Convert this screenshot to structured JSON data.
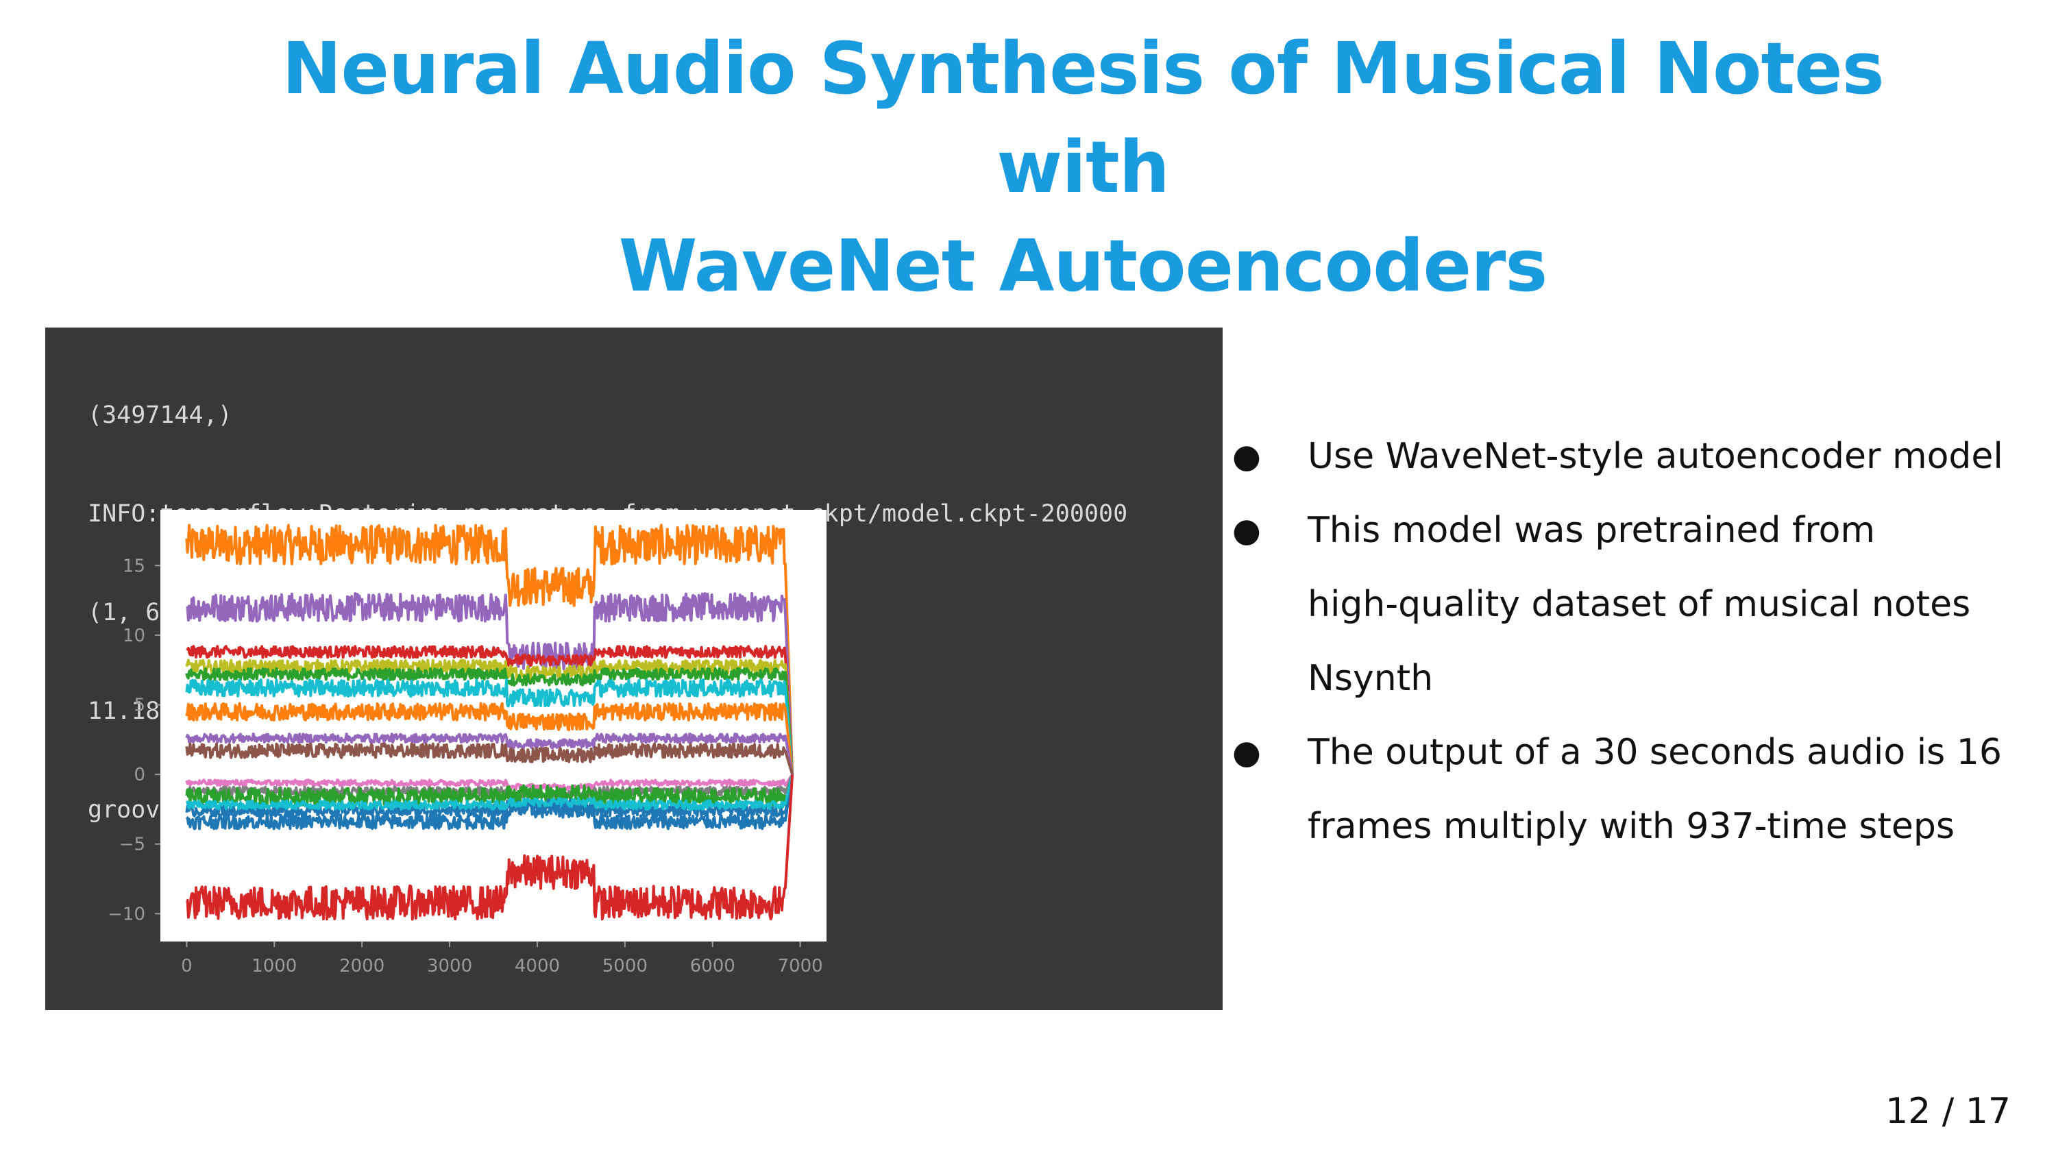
{
  "slide": {
    "title_line1": "Neural Audio Synthesis of Musical Notes with",
    "title_line2": "WaveNet Autoencoders",
    "page_number": "12 / 17"
  },
  "console": {
    "lines": [
      "(3497144,)",
      "INFO:tensorflow:Restoring parameters from wavenet-ckpt/model.ckpt-200000",
      "(1, 6830, 16)",
      "11.186204195022583",
      "groovy and funny"
    ]
  },
  "bullets": [
    {
      "lines": [
        "Use WaveNet-style autoencoder model"
      ]
    },
    {
      "lines": [
        "This model was pretrained from",
        "high-quality dataset of musical notes",
        "Nsynth"
      ]
    },
    {
      "lines": [
        "The output of a 30 seconds audio is 16",
        "frames multiply with 937-time steps"
      ]
    }
  ],
  "chart_data": {
    "type": "line",
    "xlim": [
      -300,
      7300
    ],
    "ylim": [
      -12,
      19
    ],
    "x_ticks": [
      0,
      1000,
      2000,
      3000,
      4000,
      5000,
      6000,
      7000
    ],
    "x_tick_labels": [
      "0",
      "1000",
      "2000",
      "3000",
      "4000",
      "5000",
      "6000",
      "7000"
    ],
    "y_ticks": [
      15,
      10,
      5,
      0,
      -5,
      -10
    ],
    "y_tick_labels": [
      "15",
      "10",
      "5",
      "0",
      "−5",
      "−10"
    ],
    "x_end": 6830,
    "n_series": 16,
    "series": [
      {
        "color": "#ff7f0e",
        "levels": [
          16.5,
          13.5,
          16.5
        ],
        "noise": 1.4
      },
      {
        "color": "#9467bd",
        "levels": [
          12.0,
          8.5,
          12.0
        ],
        "noise": 1.0
      },
      {
        "color": "#d62728",
        "levels": [
          8.8,
          8.2,
          8.8
        ],
        "noise": 0.4
      },
      {
        "color": "#bcbd22",
        "levels": [
          7.7,
          7.3,
          7.7
        ],
        "noise": 0.5
      },
      {
        "color": "#2ca02c",
        "levels": [
          7.2,
          6.8,
          7.2
        ],
        "noise": 0.4
      },
      {
        "color": "#17becf",
        "levels": [
          6.2,
          5.5,
          6.2
        ],
        "noise": 0.6
      },
      {
        "color": "#ff7f0e",
        "levels": [
          4.5,
          3.8,
          4.5
        ],
        "noise": 0.6
      },
      {
        "color": "#9467bd",
        "levels": [
          2.6,
          2.2,
          2.6
        ],
        "noise": 0.3
      },
      {
        "color": "#8c564b",
        "levels": [
          1.7,
          1.4,
          1.7
        ],
        "noise": 0.5
      },
      {
        "color": "#e377c2",
        "levels": [
          -0.6,
          -0.9,
          -0.6
        ],
        "noise": 0.2
      },
      {
        "color": "#7f7f7f",
        "levels": [
          -1.2,
          -1.5,
          -1.2
        ],
        "noise": 0.3
      },
      {
        "color": "#2ca02c",
        "levels": [
          -1.6,
          -1.4,
          -1.6
        ],
        "noise": 0.6
      },
      {
        "color": "#1f77b4",
        "levels": [
          -2.6,
          -2.2,
          -2.6
        ],
        "noise": 0.4
      },
      {
        "color": "#1f77b4",
        "levels": [
          -3.4,
          -2.6,
          -3.4
        ],
        "noise": 0.5
      },
      {
        "color": "#17becf",
        "levels": [
          -2.2,
          -2.0,
          -2.2
        ],
        "noise": 0.3
      },
      {
        "color": "#d62728",
        "levels": [
          -9.2,
          -7.0,
          -9.2
        ],
        "noise": 1.2
      }
    ]
  }
}
